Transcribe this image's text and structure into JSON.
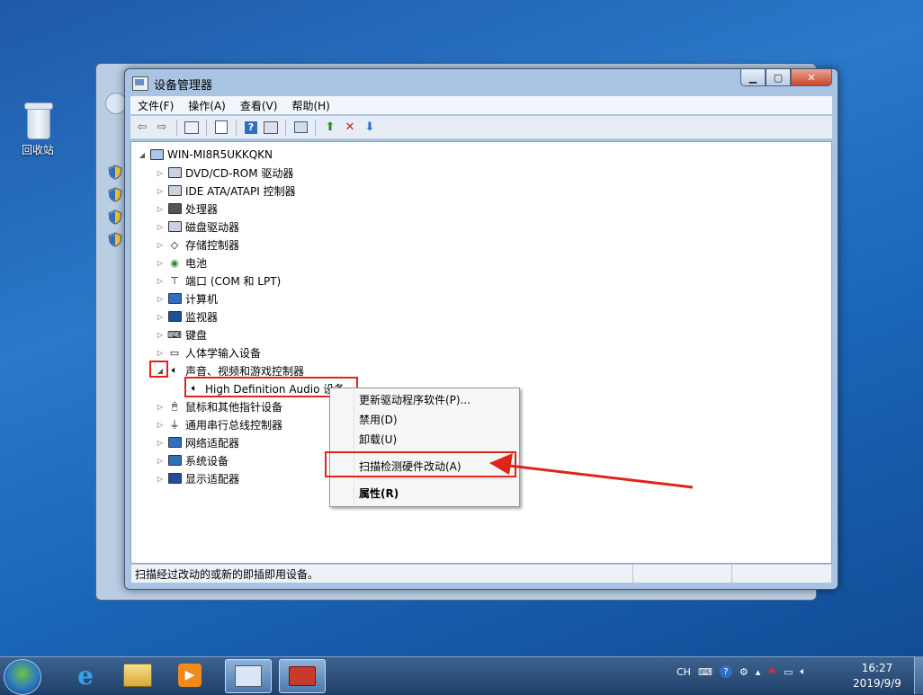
{
  "desktop": {
    "recycle_bin": "回收站"
  },
  "window": {
    "title": "设备管理器",
    "menu": [
      "文件(F)",
      "操作(A)",
      "查看(V)",
      "帮助(H)"
    ],
    "tree": {
      "root": "WIN-MI8R5UKKQKN",
      "items": [
        {
          "label": "DVD/CD-ROM 驱动器",
          "icon": "disc-drive-icon"
        },
        {
          "label": "IDE ATA/ATAPI 控制器",
          "icon": "ide-controller-icon"
        },
        {
          "label": "处理器",
          "icon": "processor-icon"
        },
        {
          "label": "磁盘驱动器",
          "icon": "disk-drive-icon"
        },
        {
          "label": "存储控制器",
          "icon": "storage-controller-icon"
        },
        {
          "label": "电池",
          "icon": "battery-icon"
        },
        {
          "label": "端口 (COM 和 LPT)",
          "icon": "port-icon"
        },
        {
          "label": "计算机",
          "icon": "computer-icon"
        },
        {
          "label": "监视器",
          "icon": "monitor-icon"
        },
        {
          "label": "键盘",
          "icon": "keyboard-icon"
        },
        {
          "label": "人体学输入设备",
          "icon": "hid-icon"
        },
        {
          "label": "声音、视频和游戏控制器",
          "icon": "speaker-icon"
        },
        {
          "label": "High Definition Audio 设备",
          "icon": "speaker-icon"
        },
        {
          "label": "鼠标和其他指针设备",
          "icon": "mouse-icon"
        },
        {
          "label": "通用串行总线控制器",
          "icon": "usb-icon"
        },
        {
          "label": "网络适配器",
          "icon": "network-adapter-icon"
        },
        {
          "label": "系统设备",
          "icon": "system-device-icon"
        },
        {
          "label": "显示适配器",
          "icon": "display-adapter-icon"
        }
      ]
    },
    "status_text": "扫描经过改动的或新的即插即用设备。"
  },
  "context_menu": {
    "update_driver": "更新驱动程序软件(P)...",
    "disable": "禁用(D)",
    "uninstall": "卸载(U)",
    "scan": "扫描检测硬件改动(A)",
    "properties": "属性(R)"
  },
  "taskbar": {
    "lang": "CH",
    "time": "16:27",
    "date": "2019/9/9"
  },
  "colors": {
    "highlight": "#e2231a",
    "accent": "#1e5aa8"
  }
}
